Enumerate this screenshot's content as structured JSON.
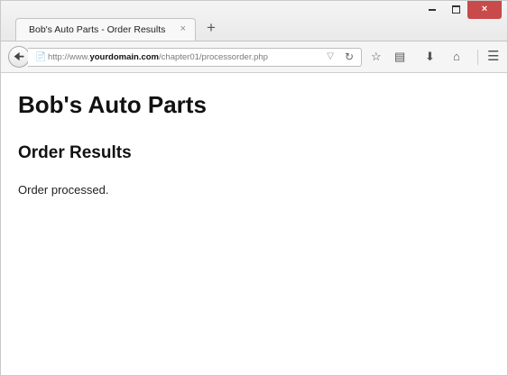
{
  "window": {
    "tab_title": "Bob's Auto Parts - Order Results",
    "tab_close": "×",
    "new_tab": "+",
    "close_glyph": "×"
  },
  "navbar": {
    "url_prefix": "http://www.",
    "url_domain": "yourdomain.com",
    "url_path": "/chapter01/processorder.php",
    "icons": [
      "back-arrow-icon",
      "site-identity-icon",
      "dropdown-icon",
      "reload-icon",
      "bookmark-star-icon",
      "reading-list-icon",
      "download-icon",
      "home-icon",
      "menu-icon"
    ]
  },
  "page": {
    "heading": "Bob's Auto Parts",
    "subheading": "Order Results",
    "message": "Order processed."
  },
  "colors": {
    "close_button": "#c94a4a",
    "chrome_background": "#f1f1f1",
    "content_background": "#ffffff"
  }
}
